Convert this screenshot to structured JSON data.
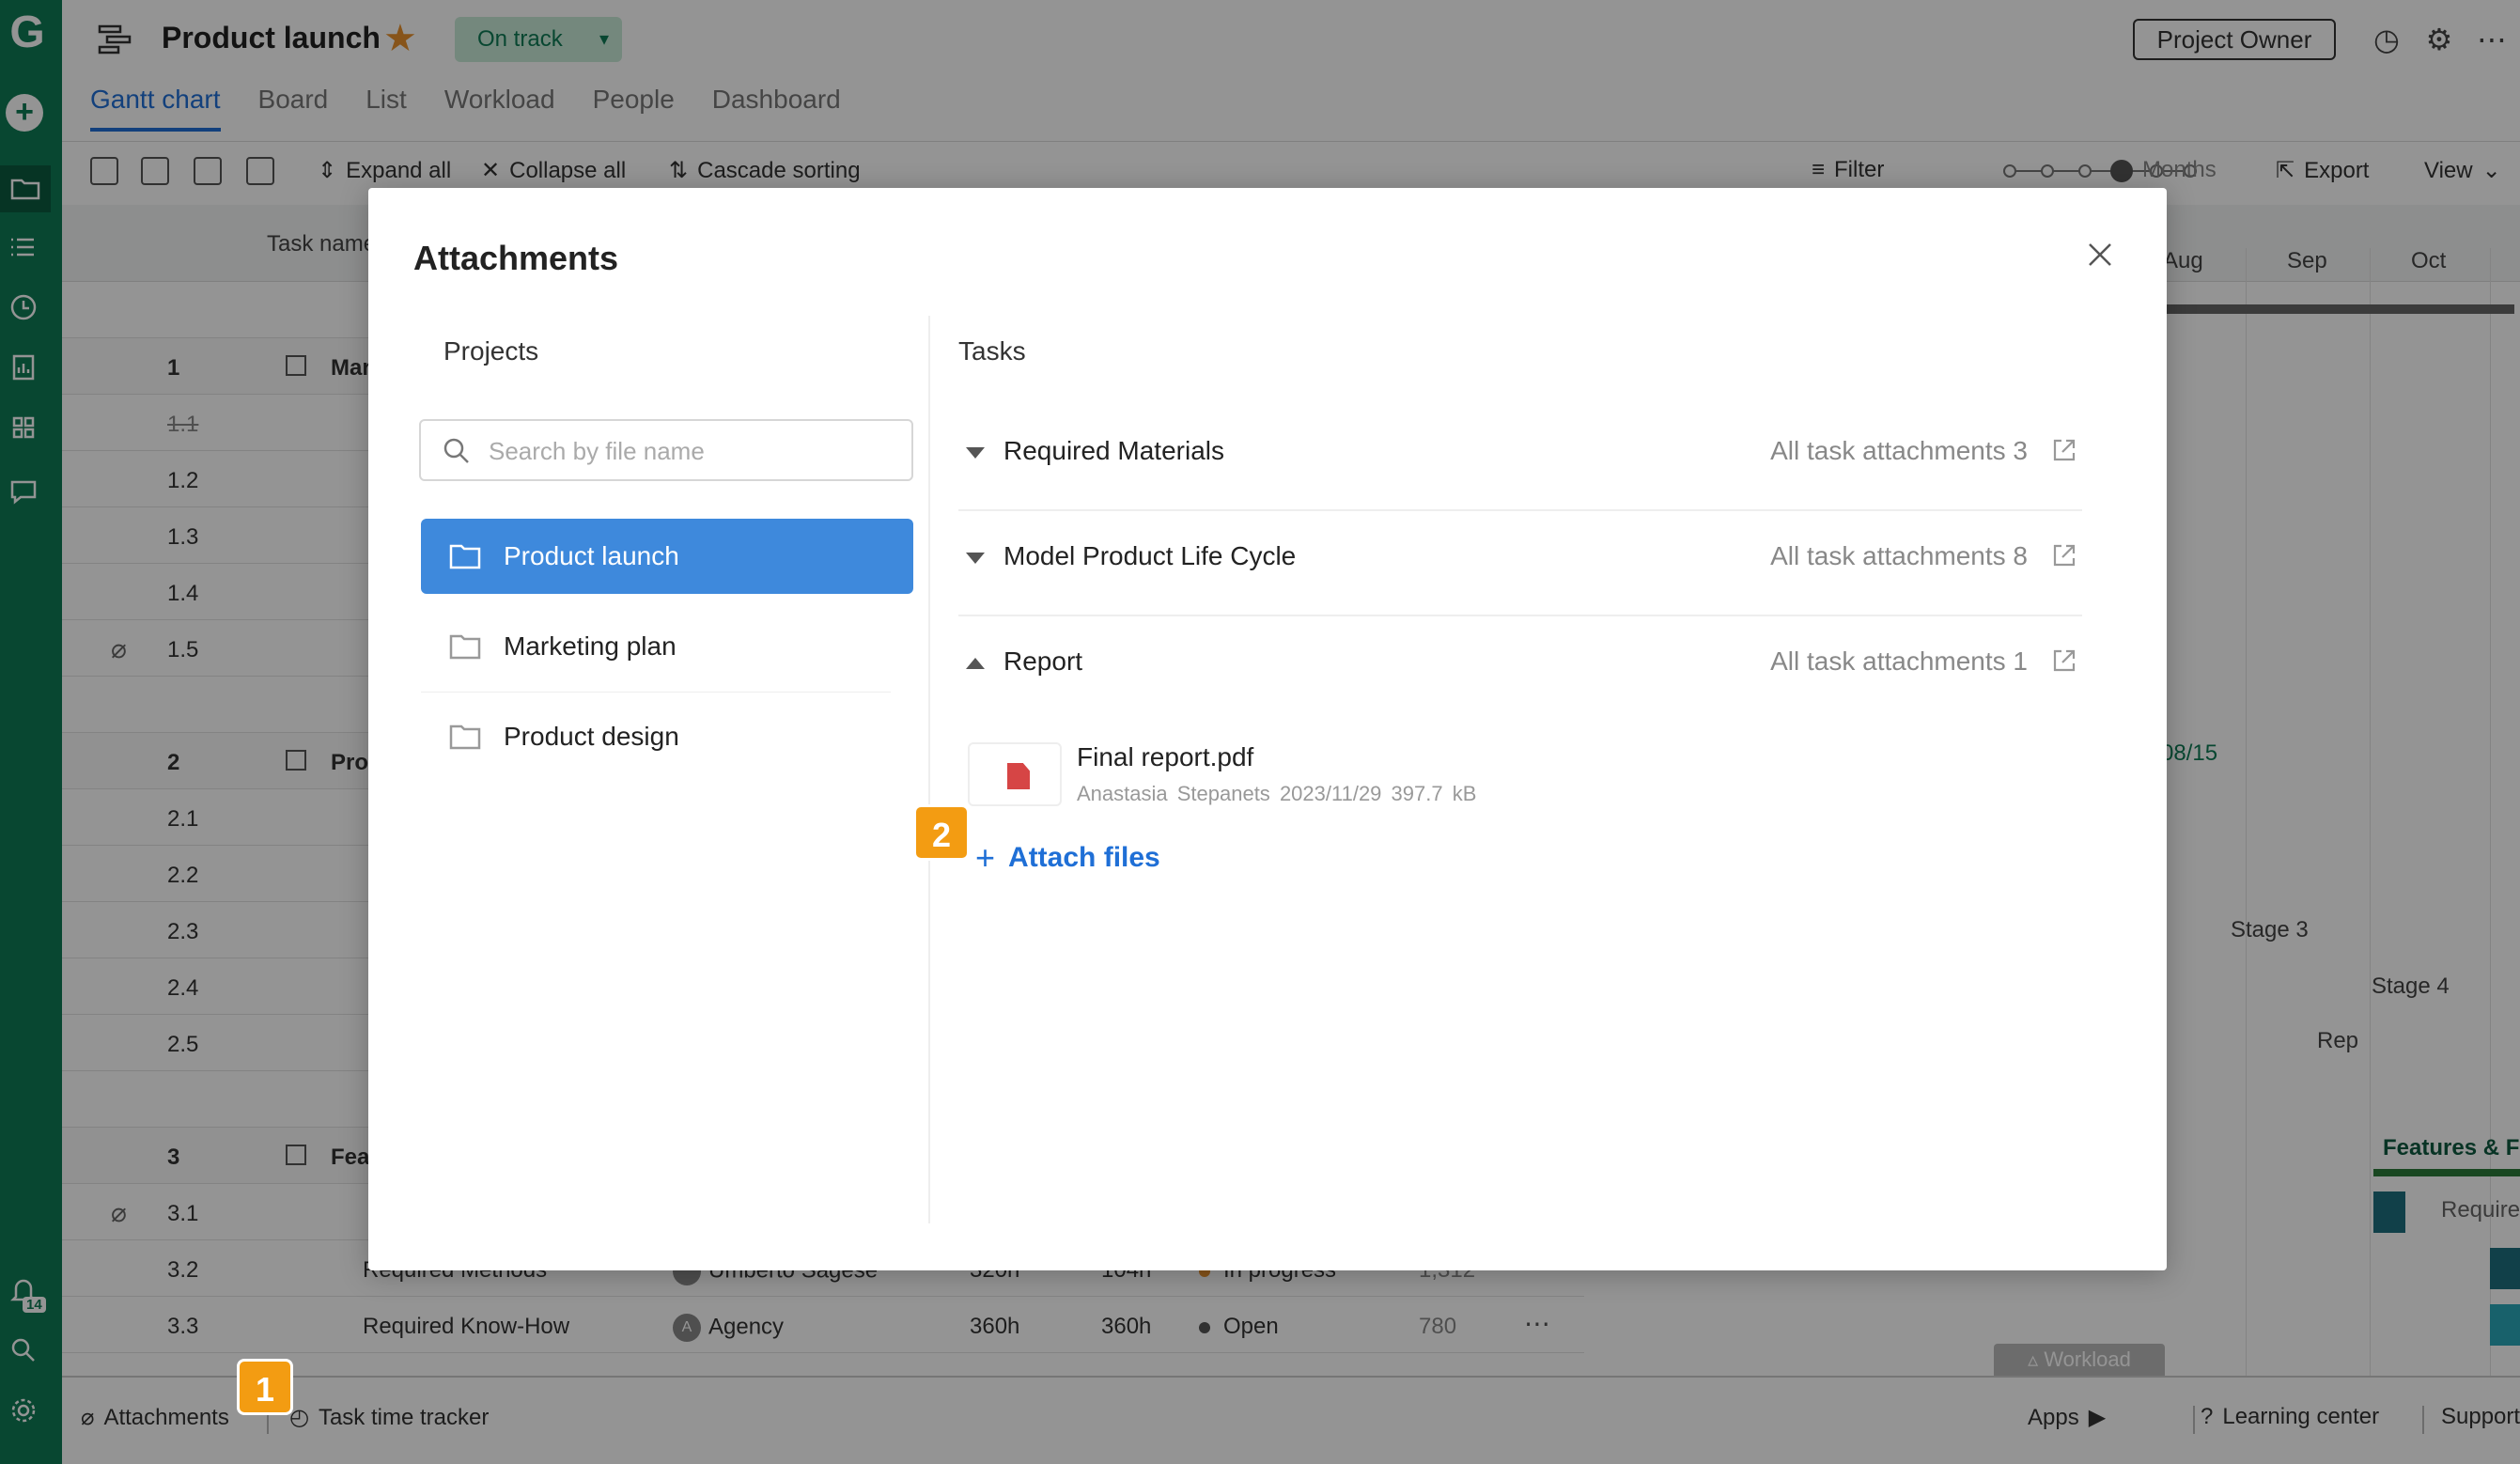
{
  "header": {
    "title": "Product launch",
    "status": "On track",
    "owner_button": "Project Owner"
  },
  "tabs": [
    "Gantt chart",
    "Board",
    "List",
    "Workload",
    "People",
    "Dashboard"
  ],
  "toolbar": {
    "expand_all": "Expand all",
    "collapse_all": "Collapse all",
    "cascade_sorting": "Cascade sorting",
    "filter": "Filter",
    "zoom_label": "Months",
    "export": "Export",
    "view": "View"
  },
  "grid": {
    "task_name_header": "Task name",
    "rows": [
      {
        "num": "1",
        "text": "Mar"
      },
      {
        "num": "1.1",
        "text": ""
      },
      {
        "num": "1.2",
        "text": ""
      },
      {
        "num": "1.3",
        "text": ""
      },
      {
        "num": "1.4",
        "text": ""
      },
      {
        "num": "1.5",
        "text": ""
      },
      {
        "num": "2",
        "text": "Pro"
      },
      {
        "num": "2.1",
        "text": ""
      },
      {
        "num": "2.2",
        "text": ""
      },
      {
        "num": "2.3",
        "text": ""
      },
      {
        "num": "2.4",
        "text": ""
      },
      {
        "num": "2.5",
        "text": ""
      },
      {
        "num": "3",
        "text": "Feat"
      },
      {
        "num": "3.1",
        "text": ""
      },
      {
        "num": "3.2",
        "text": "Required Methods",
        "assignee": "Umberto Sagese",
        "h1": "320h",
        "h2": "104h",
        "status": "In progress",
        "cost": "1,312"
      },
      {
        "num": "3.3",
        "text": "Required Know-How",
        "assignee": "Agency",
        "h1": "360h",
        "h2": "360h",
        "status": "Open",
        "cost": "780"
      }
    ]
  },
  "timeline": {
    "months": [
      "Aug",
      "Sep",
      "Oct"
    ],
    "date_label": "08/15",
    "stage3": "Stage 3",
    "stage4": "Stage 4",
    "report": "Rep",
    "features": "Features & F",
    "require": "Require",
    "workload_tab": "Workload"
  },
  "bottombar": {
    "attachments": "Attachments",
    "task_time_tracker": "Task time tracker",
    "apps": "Apps",
    "learning_center": "Learning center",
    "support": "Support"
  },
  "modal": {
    "title": "Attachments",
    "projects_heading": "Projects",
    "tasks_heading": "Tasks",
    "search_placeholder": "Search by file name",
    "projects": [
      "Product launch",
      "Marketing plan",
      "Product design"
    ],
    "tasks": [
      {
        "name": "Required Materials",
        "all": "All task attachments 3",
        "expanded": false
      },
      {
        "name": "Model Product Life Cycle",
        "all": "All task attachments 8",
        "expanded": false
      },
      {
        "name": "Report",
        "all": "All task attachments 1",
        "expanded": true
      }
    ],
    "file": {
      "name": "Final report.pdf",
      "author": "Anastasia Stepanets",
      "date": "2023/11/29",
      "size": "397.7 kB"
    },
    "attach_files": "Attach files"
  },
  "callouts": [
    "1",
    "2"
  ],
  "colors": {
    "rail": "#0f7a55",
    "accent": "#1f6fd6",
    "selected_project": "#3e89dc",
    "callout": "#f39c12",
    "star": "#e8912d"
  }
}
